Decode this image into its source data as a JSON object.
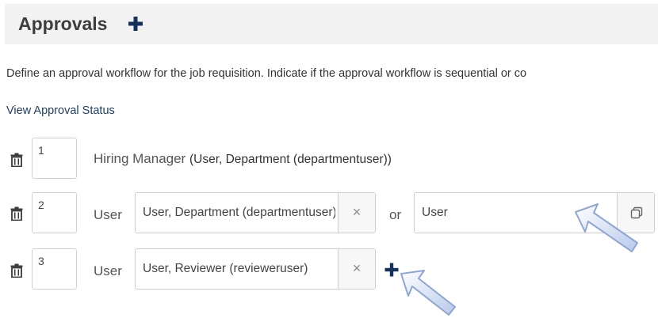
{
  "header": {
    "title": "Approvals",
    "add_icon": "plus-icon"
  },
  "description": "Define an approval workflow for the job requisition. Indicate if the approval workflow is sequential or co",
  "status_link": "View Approval Status",
  "rows": [
    {
      "step": "1",
      "label": "Hiring Manager",
      "detail": "(User, Department (departmentuser))"
    },
    {
      "step": "2",
      "label": "User",
      "approver_value": "User, Department (departmentuser)",
      "clear_icon": "×",
      "or_label": "or",
      "alternate_value": "User",
      "copy_icon": "copy-icon"
    },
    {
      "step": "3",
      "label": "User",
      "approver_value": "User, Reviewer (revieweruser)",
      "clear_icon": "×",
      "add_icon": "plus-icon"
    }
  ],
  "colors": {
    "header_bg": "#f2f2f2",
    "accent_navy": "#14325c",
    "link": "#1f3f66",
    "annotation_arrow": "#a9bfe4"
  }
}
